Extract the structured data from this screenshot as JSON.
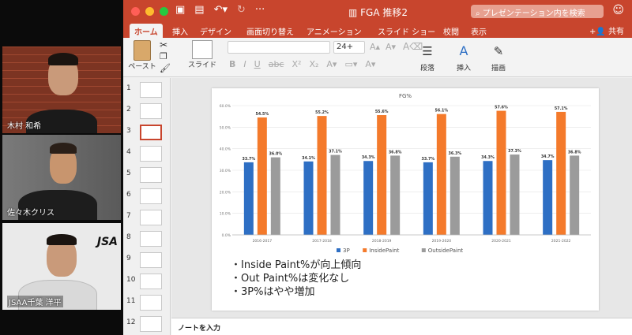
{
  "participants": [
    {
      "name": "木村 和希"
    },
    {
      "name": "佐々木クリス"
    },
    {
      "name": "JSAA千葉 洋平"
    }
  ],
  "window": {
    "title": "FGA 推移2",
    "search_placeholder": "プレゼンテーション内を検索",
    "share_label": "共有"
  },
  "tabs": [
    "ホーム",
    "挿入",
    "デザイン",
    "画面切り替え",
    "アニメーション",
    "スライド ショー",
    "校閲",
    "表示"
  ],
  "ribbon": {
    "paste_label": "ペースト",
    "slide_label": "スライド",
    "font_size": "24+",
    "paragraph_label": "段落",
    "insert_label": "挿入",
    "draw_label": "描画"
  },
  "thumbnails": [
    "1",
    "2",
    "3",
    "4",
    "5",
    "6",
    "7",
    "8",
    "9",
    "10",
    "11",
    "12"
  ],
  "notes_placeholder": "ノートを入力",
  "slide": {
    "bullets": [
      "・Inside Paint%が向上傾向",
      "・Out Paint%は変化なし",
      "・3P%はやや増加"
    ]
  },
  "chart_data": {
    "type": "bar",
    "title": "FG%",
    "categories": [
      "2016-2017",
      "2017-2018",
      "2018-2019",
      "2019-2020",
      "2020-2021",
      "2021-2022"
    ],
    "series": [
      {
        "name": "3P",
        "color": "#2e6fc4",
        "values": [
          33.7,
          34.1,
          34.3,
          33.7,
          34.3,
          34.7
        ],
        "labels": [
          "33.7%",
          "34.1%",
          "34.3%",
          "33.7%",
          "34.3%",
          "34.7%"
        ]
      },
      {
        "name": "InsidePaint",
        "color": "#f47a2b",
        "values": [
          54.5,
          55.2,
          55.6,
          56.1,
          57.6,
          57.1
        ],
        "labels": [
          "54.5%",
          "55.2%",
          "55.6%",
          "56.1%",
          "57.6%",
          "57.1%"
        ]
      },
      {
        "name": "OutsidePaint",
        "color": "#9b9b9b",
        "values": [
          36.0,
          37.1,
          36.8,
          36.3,
          37.3,
          36.8
        ],
        "labels": [
          "36.0%",
          "37.1%",
          "36.8%",
          "36.3%",
          "37.3%",
          "36.8%"
        ]
      }
    ],
    "yticks": [
      "0.0%",
      "10.0%",
      "20.0%",
      "30.0%",
      "40.0%",
      "50.0%",
      "60.0%"
    ],
    "ylim": [
      0,
      60
    ],
    "grid": true,
    "legend": "bottom"
  }
}
